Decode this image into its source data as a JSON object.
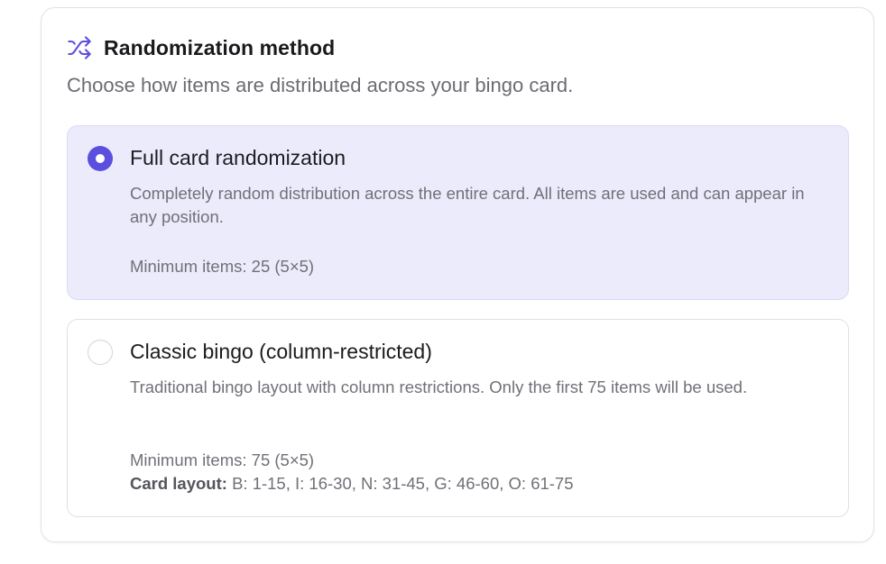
{
  "section": {
    "icon": "shuffle-icon",
    "title": "Randomization method",
    "subtitle": "Choose how items are distributed across your bingo card."
  },
  "options": [
    {
      "selected": true,
      "title": "Full card randomization",
      "description": "Completely random distribution across the entire card. All items are used and can appear in any position.",
      "min_items": "Minimum items: 25 (5×5)"
    },
    {
      "selected": false,
      "title": "Classic bingo (column-restricted)",
      "description": "Traditional bingo layout with column restrictions. Only the first 75 items will be used.",
      "min_items": "Minimum items: 75 (5×5)",
      "layout_label": "Card layout:",
      "layout_value": " B: 1-15, I: 16-30, N: 31-45, G: 46-60, O: 61-75"
    }
  ],
  "colors": {
    "accent": "#5b4fe0",
    "selected_bg": "#ecebfb"
  }
}
